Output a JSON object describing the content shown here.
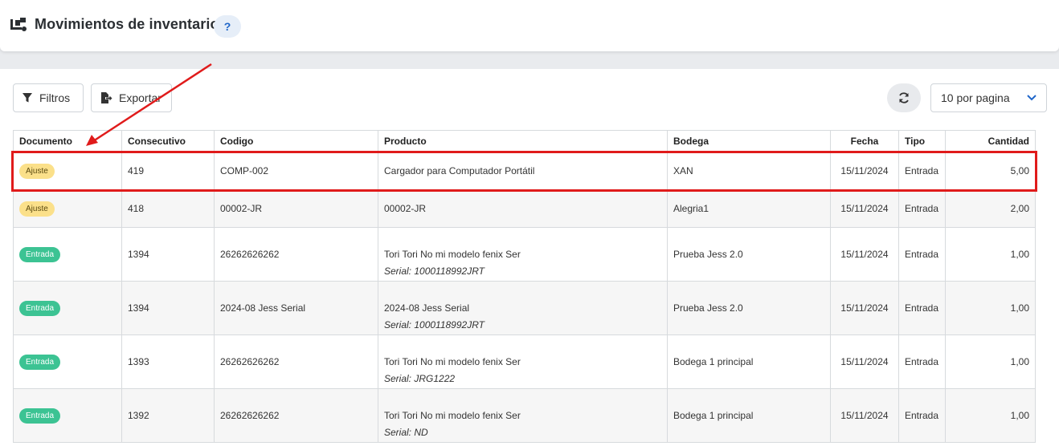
{
  "header": {
    "title": "Movimientos de inventario",
    "help_label": "?",
    "icon": "truck-ramp-icon"
  },
  "toolbar": {
    "filters_label": "Filtros",
    "export_label": "Exportar",
    "per_page_value": "10 por pagina"
  },
  "colors": {
    "highlight": "#e01b1b",
    "badge_ajuste": "#fbe08a",
    "badge_entrada": "#3cc393",
    "help_text": "#1f66c9"
  },
  "table": {
    "headers": {
      "documento": "Documento",
      "consecutivo": "Consecutivo",
      "codigo": "Codigo",
      "producto": "Producto",
      "bodega": "Bodega",
      "fecha": "Fecha",
      "tipo": "Tipo",
      "cantidad": "Cantidad"
    },
    "rows": [
      {
        "documento": "Ajuste",
        "consecutivo": "419",
        "codigo": "COMP-002",
        "producto": "Cargador para Computador Portátil",
        "serial": "",
        "bodega": "XAN",
        "fecha": "15/11/2024",
        "tipo": "Entrada",
        "cantidad": "5,00"
      },
      {
        "documento": "Ajuste",
        "consecutivo": "418",
        "codigo": "00002-JR",
        "producto": "00002-JR",
        "serial": "",
        "bodega": "Alegria1",
        "fecha": "15/11/2024",
        "tipo": "Entrada",
        "cantidad": "2,00"
      },
      {
        "documento": "Entrada",
        "consecutivo": "1394",
        "codigo": "26262626262",
        "producto": "Tori Tori No mi modelo fenix Ser",
        "serial": "Serial: 1000118992JRT",
        "bodega": "Prueba Jess 2.0",
        "fecha": "15/11/2024",
        "tipo": "Entrada",
        "cantidad": "1,00"
      },
      {
        "documento": "Entrada",
        "consecutivo": "1394",
        "codigo": "2024-08 Jess Serial",
        "producto": "2024-08 Jess Serial",
        "serial": "Serial: 1000118992JRT",
        "bodega": "Prueba Jess 2.0",
        "fecha": "15/11/2024",
        "tipo": "Entrada",
        "cantidad": "1,00"
      },
      {
        "documento": "Entrada",
        "consecutivo": "1393",
        "codigo": "26262626262",
        "producto": "Tori Tori No mi modelo fenix Ser",
        "serial": "Serial: JRG1222",
        "bodega": "Bodega 1 principal",
        "fecha": "15/11/2024",
        "tipo": "Entrada",
        "cantidad": "1,00"
      },
      {
        "documento": "Entrada",
        "consecutivo": "1392",
        "codigo": "26262626262",
        "producto": "Tori Tori No mi modelo fenix Ser",
        "serial": "Serial: ND",
        "bodega": "Bodega 1 principal",
        "fecha": "15/11/2024",
        "tipo": "Entrada",
        "cantidad": "1,00"
      }
    ]
  }
}
